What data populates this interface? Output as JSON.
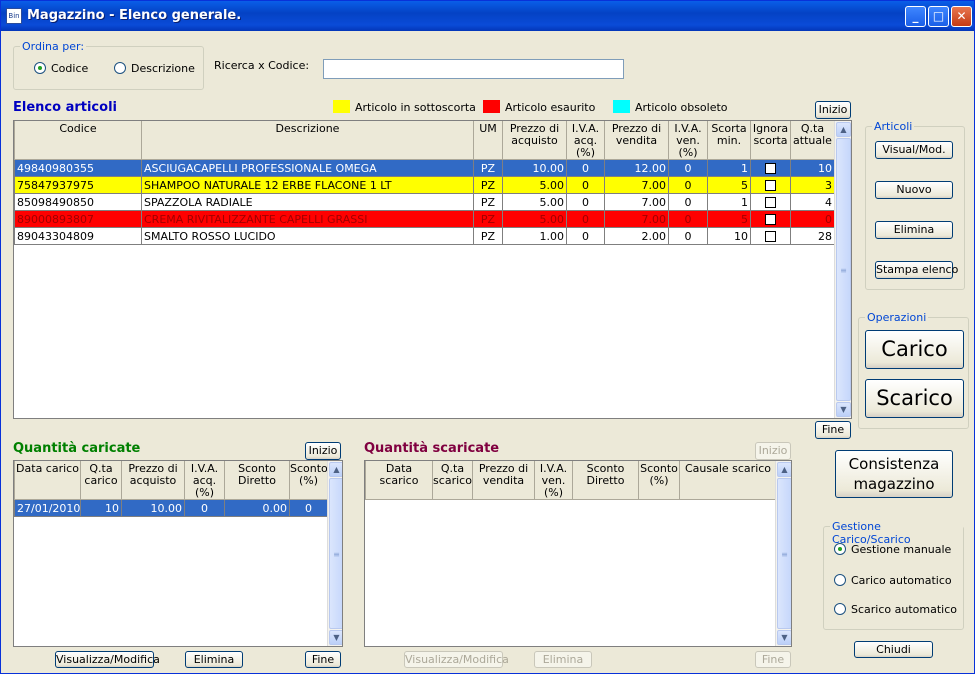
{
  "window": {
    "title": "Magazzino - Elenco generale.",
    "app_icon_text": "Bin"
  },
  "sort": {
    "legend": "Ordina per:",
    "options": [
      {
        "label": "Codice",
        "selected": true
      },
      {
        "label": "Descrizione",
        "selected": false
      }
    ]
  },
  "search": {
    "label": "Ricerca x Codice:",
    "value": ""
  },
  "articles": {
    "title": "Elenco articoli",
    "legend": [
      {
        "label": "Articolo in sottoscorta",
        "color": "#ffff00"
      },
      {
        "label": "Articolo esaurito",
        "color": "#ff0000"
      },
      {
        "label": "Articolo obsoleto",
        "color": "#00ffff"
      }
    ],
    "inizio": "Inizio",
    "fine": "Fine",
    "columns": [
      "Codice",
      "Descrizione",
      "UM",
      "Prezzo di acquisto",
      "I.V.A. acq.(%)",
      "Prezzo di vendita",
      "I.V.A. ven.(%)",
      "Scorta min.",
      "Ignora scorta",
      "Q.ta attuale"
    ],
    "rows": [
      {
        "codice": "49840980355",
        "descrizione": "ASCIUGACAPELLI PROFESSIONALE OMEGA",
        "um": "PZ",
        "prezzo_acquisto": "10.00",
        "iva_acq": "0",
        "prezzo_vendita": "12.00",
        "iva_ven": "0",
        "scorta_min": "1",
        "ignora": false,
        "qta": "10",
        "status": "selected"
      },
      {
        "codice": "75847937975",
        "descrizione": "SHAMPOO NATURALE 12 ERBE FLACONE 1 LT",
        "um": "PZ",
        "prezzo_acquisto": "5.00",
        "iva_acq": "0",
        "prezzo_vendita": "7.00",
        "iva_ven": "0",
        "scorta_min": "5",
        "ignora": false,
        "qta": "3",
        "status": "sottoscorta"
      },
      {
        "codice": "85098490850",
        "descrizione": "SPAZZOLA RADIALE",
        "um": "PZ",
        "prezzo_acquisto": "5.00",
        "iva_acq": "0",
        "prezzo_vendita": "7.00",
        "iva_ven": "0",
        "scorta_min": "1",
        "ignora": false,
        "qta": "4",
        "status": "normal"
      },
      {
        "codice": "89000893807",
        "descrizione": "CREMA RIVITALIZZANTE CAPELLI GRASSI",
        "um": "PZ",
        "prezzo_acquisto": "5.00",
        "iva_acq": "0",
        "prezzo_vendita": "7.00",
        "iva_ven": "0",
        "scorta_min": "5",
        "ignora": false,
        "qta": "0",
        "status": "esaurito"
      },
      {
        "codice": "89043304809",
        "descrizione": "SMALTO ROSSO LUCIDO",
        "um": "PZ",
        "prezzo_acquisto": "1.00",
        "iva_acq": "0",
        "prezzo_vendita": "2.00",
        "iva_ven": "0",
        "scorta_min": "10",
        "ignora": false,
        "qta": "28",
        "status": "normal"
      }
    ]
  },
  "articoli_panel": {
    "legend": "Articoli",
    "visual": "Visual/Mod.",
    "nuovo": "Nuovo",
    "elimina": "Elimina",
    "stampa": "Stampa elenco"
  },
  "operazioni": {
    "legend": "Operazioni",
    "carico": "Carico",
    "scarico": "Scarico"
  },
  "consistenza": {
    "line1": "Consistenza",
    "line2": "magazzino"
  },
  "gestione": {
    "legend": "Gestione Carico/Scarico",
    "options": [
      {
        "label": "Gestione manuale",
        "selected": true
      },
      {
        "label": "Carico automatico",
        "selected": false
      },
      {
        "label": "Scarico automatico",
        "selected": false
      }
    ]
  },
  "chiudi": "Chiudi",
  "caricate": {
    "title": "Quantità caricate",
    "inizio": "Inizio",
    "columns": [
      "Data carico",
      "Q.ta carico",
      "Prezzo di acquisto",
      "I.V.A. acq.(%)",
      "Sconto Diretto",
      "Sconto (%)"
    ],
    "rows": [
      {
        "data": "27/01/2010",
        "qta": "10",
        "prezzo": "10.00",
        "iva": "0",
        "sconto_diretto": "0.00",
        "sconto_pct": "0"
      }
    ],
    "visualizza": "Visualizza/Modifica",
    "elimina": "Elimina",
    "fine": "Fine"
  },
  "scaricate": {
    "title": "Quantità scaricate",
    "inizio": "Inizio",
    "columns": [
      "Data scarico",
      "Q.ta scarico",
      "Prezzo di vendita",
      "I.V.A. ven.(%)",
      "Sconto Diretto",
      "Sconto (%)",
      "Causale scarico"
    ],
    "rows": [],
    "visualizza": "Visualizza/Modifica",
    "elimina": "Elimina",
    "fine": "Fine"
  },
  "colors": {
    "title_green": "#008000",
    "title_maroon": "#800040",
    "title_blue": "#0000c0",
    "selection": "#316ac5"
  }
}
